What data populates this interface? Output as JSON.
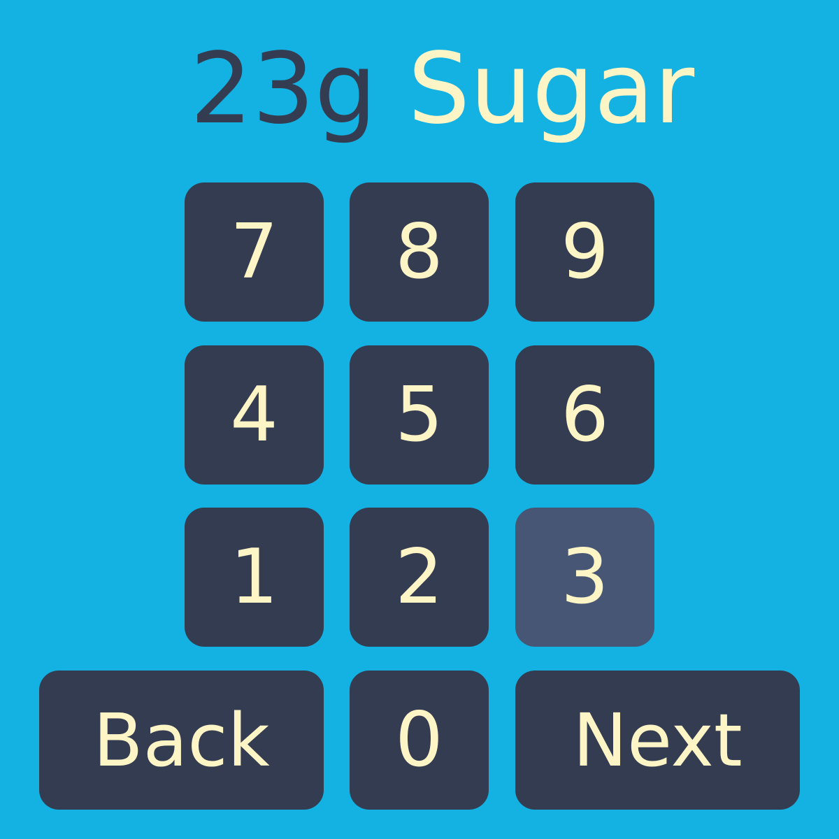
{
  "header": {
    "amount": "23g",
    "nutrient": "Sugar"
  },
  "keypad": {
    "keys": {
      "7": "7",
      "8": "8",
      "9": "9",
      "4": "4",
      "5": "5",
      "6": "6",
      "1": "1",
      "2": "2",
      "3": "3",
      "0": "0"
    },
    "back_label": "Back",
    "next_label": "Next",
    "selected_key": "3"
  },
  "colors": {
    "background": "#13b2e2",
    "key_background": "#343c52",
    "key_selected_background": "#465674",
    "key_text": "#fef5c6",
    "amount_text": "#343c52",
    "label_text": "#fef5c6"
  }
}
